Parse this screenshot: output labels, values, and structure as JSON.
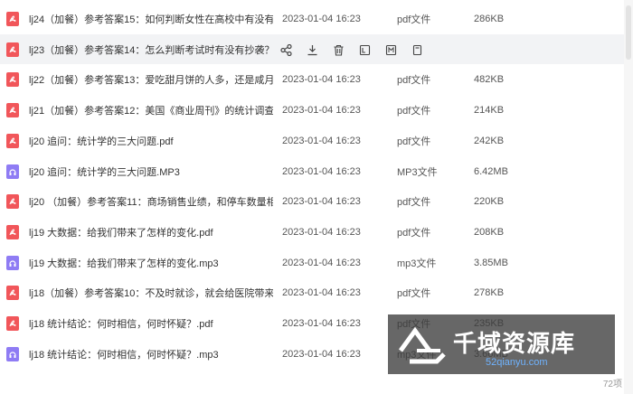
{
  "files": [
    {
      "name": "lj24（加餐）参考答案15：如何判断女性在高校中有没有...",
      "date": "2023-01-04 16:23",
      "type": "pdf文件",
      "size": "286KB",
      "kind": "pdf"
    },
    {
      "name": "lj23（加餐）参考答案14：怎么判断考试时有没有抄袭？...",
      "date": "",
      "type": "",
      "size": "",
      "kind": "pdf",
      "hovered": true
    },
    {
      "name": "lj22（加餐）参考答案13：爱吃甜月饼的人多，还是咸月...",
      "date": "2023-01-04 16:23",
      "type": "pdf文件",
      "size": "482KB",
      "kind": "pdf"
    },
    {
      "name": "lj21（加餐）参考答案12：美国《商业周刊》的统计调查...",
      "date": "2023-01-04 16:23",
      "type": "pdf文件",
      "size": "214KB",
      "kind": "pdf"
    },
    {
      "name": "lj20 追问：统计学的三大问题.pdf",
      "date": "2023-01-04 16:23",
      "type": "pdf文件",
      "size": "242KB",
      "kind": "pdf"
    },
    {
      "name": "lj20 追问：统计学的三大问题.MP3",
      "date": "2023-01-04 16:23",
      "type": "MP3文件",
      "size": "6.42MB",
      "kind": "audio"
    },
    {
      "name": "lj20 （加餐）参考答案11：商场销售业绩，和停车数量相...",
      "date": "2023-01-04 16:23",
      "type": "pdf文件",
      "size": "220KB",
      "kind": "pdf"
    },
    {
      "name": "lj19 大数据：给我们带来了怎样的变化.pdf",
      "date": "2023-01-04 16:23",
      "type": "pdf文件",
      "size": "208KB",
      "kind": "pdf"
    },
    {
      "name": "lj19 大数据：给我们带来了怎样的变化.mp3",
      "date": "2023-01-04 16:23",
      "type": "mp3文件",
      "size": "3.85MB",
      "kind": "audio"
    },
    {
      "name": "lj18（加餐）参考答案10：不及时就诊，就会给医院带来...",
      "date": "2023-01-04 16:23",
      "type": "pdf文件",
      "size": "278KB",
      "kind": "pdf"
    },
    {
      "name": "lj18 统计结论：何时相信，何时怀疑？.pdf",
      "date": "2023-01-04 16:23",
      "type": "pdf文件",
      "size": "235KB",
      "kind": "pdf"
    },
    {
      "name": "lj18 统计结论：何时相信，何时怀疑？.mp3",
      "date": "2023-01-04 16:23",
      "type": "mp3文件",
      "size": "3.66MB",
      "kind": "audio"
    }
  ],
  "row_actions": [
    "share-icon",
    "download-icon",
    "delete-icon",
    "rename-icon",
    "move-icon",
    "copy-icon"
  ],
  "footer": {
    "count": "72项"
  },
  "watermark": {
    "title": "千域资源库",
    "url": "52qianyu.com"
  },
  "colors": {
    "pdf": "#f1565a",
    "audio": "#8f7cf4",
    "hover": "#f2f3f5"
  }
}
